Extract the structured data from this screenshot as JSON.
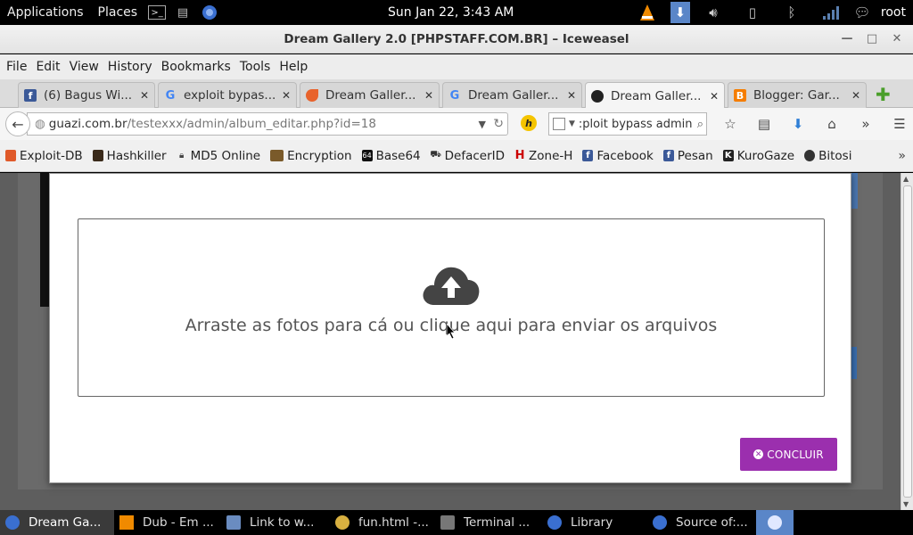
{
  "system": {
    "applications": "Applications",
    "places": "Places",
    "clock": "Sun Jan 22,  3:43 AM",
    "user": "root"
  },
  "window": {
    "title": "Dream Gallery 2.0 [PHPSTAFF.COM.BR] – Iceweasel"
  },
  "menubar": [
    "File",
    "Edit",
    "View",
    "History",
    "Bookmarks",
    "Tools",
    "Help"
  ],
  "tabs": [
    {
      "label": "(6) Bagus Wi...",
      "color": "#3b5998"
    },
    {
      "label": "exploit bypas...",
      "color": "#4285f4"
    },
    {
      "label": "Dream Galler...",
      "color": "#e8632c"
    },
    {
      "label": "Dream Galler...",
      "color": "#4285f4"
    },
    {
      "label": "Dream Galler...",
      "color": "#222222"
    },
    {
      "label": "Blogger: Gar...",
      "color": "#f57d00"
    }
  ],
  "url": {
    "host": "guazi.com.br",
    "path": "/testexxx/admin/album_editar.php?id=18"
  },
  "search": {
    "value": ":ploit bypass admin"
  },
  "bookmarks": [
    {
      "label": "Exploit-DB",
      "color": "#e05a2a"
    },
    {
      "label": "Hashkiller",
      "color": "#3a2a1a"
    },
    {
      "label": "MD5 Online",
      "color": "#444444"
    },
    {
      "label": "Encryption",
      "color": "#7a5a2a"
    },
    {
      "label": "Base64",
      "color": "#111111"
    },
    {
      "label": "DefacerID",
      "color": "#333333"
    },
    {
      "label": "Zone-H",
      "color": "#cc0000"
    },
    {
      "label": "Facebook",
      "color": "#3b5998"
    },
    {
      "label": "Pesan",
      "color": "#3b5998"
    },
    {
      "label": "KuroGaze",
      "color": "#222222"
    },
    {
      "label": "Bitosi",
      "color": "#333333"
    }
  ],
  "modal": {
    "dropzone_text": "Arraste as fotos para cá ou clique aqui para enviar os arquivos",
    "button_label": "CONCLUIR",
    "accent": "#9b2fae"
  },
  "taskbar": [
    {
      "label": "Dream Ga...",
      "color": "#3a6fd0",
      "active": true
    },
    {
      "label": "Dub - Em ...",
      "color": "#f08a00"
    },
    {
      "label": "Link to w...",
      "color": "#6a8cc0"
    },
    {
      "label": "fun.html -...",
      "color": "#d8b040"
    },
    {
      "label": "Terminal ...",
      "color": "#777777"
    },
    {
      "label": "Library",
      "color": "#3a6fd0"
    },
    {
      "label": "Source of:...",
      "color": "#3a6fd0"
    }
  ]
}
